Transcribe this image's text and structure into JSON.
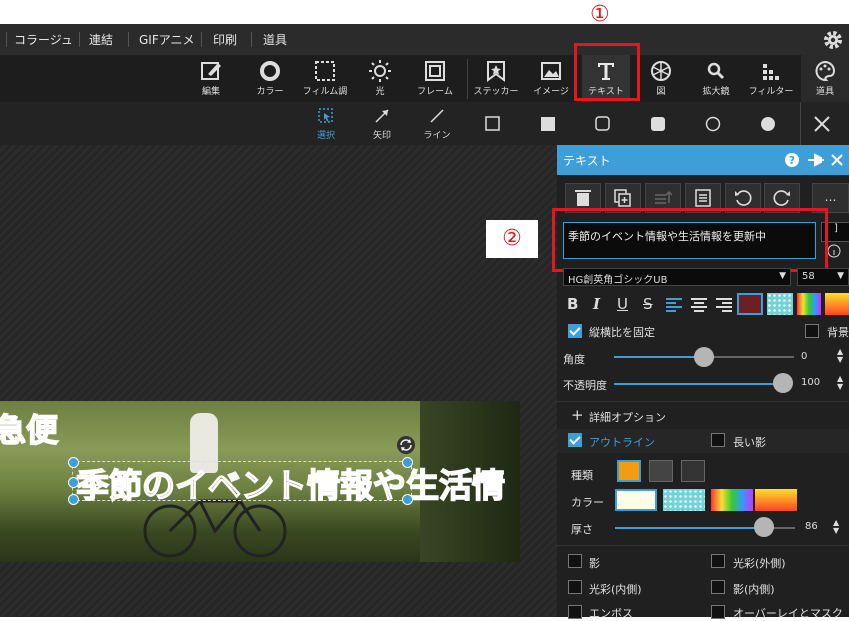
{
  "menu": {
    "items": [
      "コラージュ",
      "連結",
      "GIFアニメ",
      "印刷",
      "道具"
    ]
  },
  "toolbar": {
    "items": [
      {
        "label": "編集",
        "icon": "edit-icon"
      },
      {
        "label": "カラー",
        "icon": "color-ring-icon"
      },
      {
        "label": "フィルム調",
        "icon": "film-icon"
      },
      {
        "label": "光",
        "icon": "sun-icon"
      },
      {
        "label": "フレーム",
        "icon": "frame-icon"
      },
      {
        "label": "ステッカー",
        "icon": "sticker-icon"
      },
      {
        "label": "イメージ",
        "icon": "image-icon"
      },
      {
        "label": "テキスト",
        "icon": "text-icon"
      },
      {
        "label": "図",
        "icon": "shape-icon"
      },
      {
        "label": "拡大鏡",
        "icon": "magnifier-icon"
      },
      {
        "label": "フィルター",
        "icon": "filter-icon"
      },
      {
        "label": "道具",
        "icon": "palette-icon"
      }
    ]
  },
  "subbar": {
    "select": "選択",
    "arrow": "矢印",
    "line": "ライン"
  },
  "annotations": {
    "one": "①",
    "two": "②"
  },
  "canvas": {
    "headline": "季節のイベント情報や生活情",
    "partial": "急便"
  },
  "panel": {
    "title": "テキスト",
    "text_value": "季節のイベント情報や生活情報を更新中",
    "font": "HG創英角ゴシックUB",
    "font_size": "58",
    "keep_ratio": "縦横比を固定",
    "background": "背景",
    "angle_label": "角度",
    "angle_value": "0",
    "opacity_label": "不透明度",
    "opacity_value": "100",
    "detail_options": "詳細オプション",
    "outline": "アウトライン",
    "long_shadow": "長い影",
    "kind_label": "種類",
    "color_label": "カラー",
    "thickness_label": "厚さ",
    "thickness_value": "86",
    "effects": [
      "影",
      "光彩(外側)",
      "光彩(内側)",
      "影(内側)",
      "エンボス",
      "オーバーレイとマスク"
    ]
  },
  "colors": {
    "accent": "#3e9fd8",
    "highlight": "#e1191e",
    "text_fill": "#6e1f24"
  }
}
